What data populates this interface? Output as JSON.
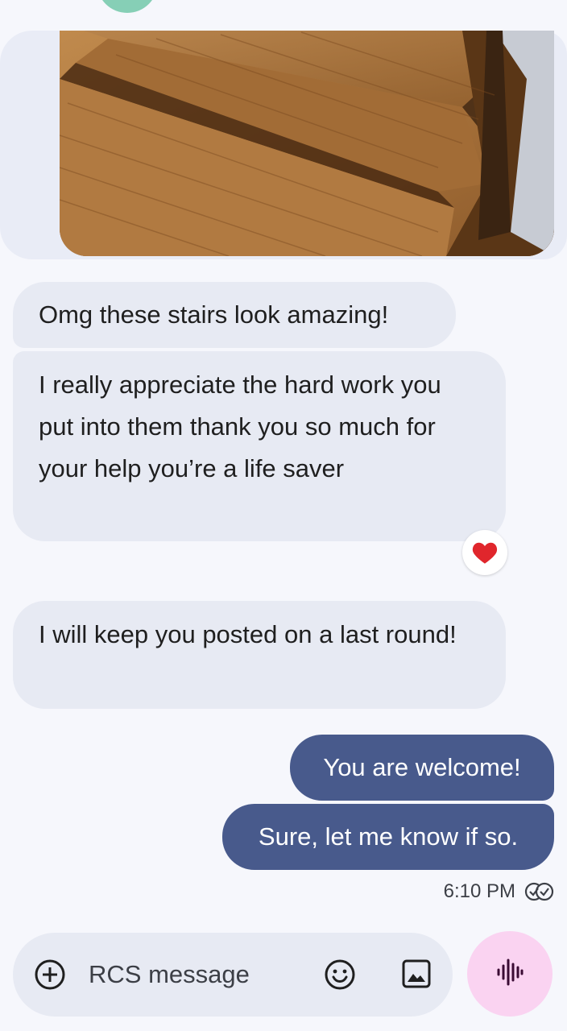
{
  "conversation": {
    "messages": [
      {
        "direction": "incoming",
        "text": "Omg these stairs look amazing!"
      },
      {
        "direction": "incoming",
        "text": "I really appreciate the hard work you put into them thank you so much for your help you’re a life saver",
        "reaction": "heart"
      },
      {
        "direction": "incoming",
        "text": "I will keep you posted on a last round!"
      },
      {
        "direction": "outgoing",
        "text": "You are welcome!"
      },
      {
        "direction": "outgoing",
        "text": "Sure, let me know if so."
      }
    ],
    "last_timestamp": "6:10 PM",
    "status_icon": "read-check-icon"
  },
  "compose": {
    "placeholder": "RCS message",
    "icons": [
      "add-circle-icon",
      "emoji-icon",
      "gallery-icon",
      "voice-waveform-icon"
    ]
  },
  "colors": {
    "background": "#f6f7fc",
    "incoming_bubble": "#e7eaf3",
    "outgoing_bubble": "#485a8c",
    "voice_button": "#fad3f1",
    "reaction_heart": "#e0262c"
  }
}
